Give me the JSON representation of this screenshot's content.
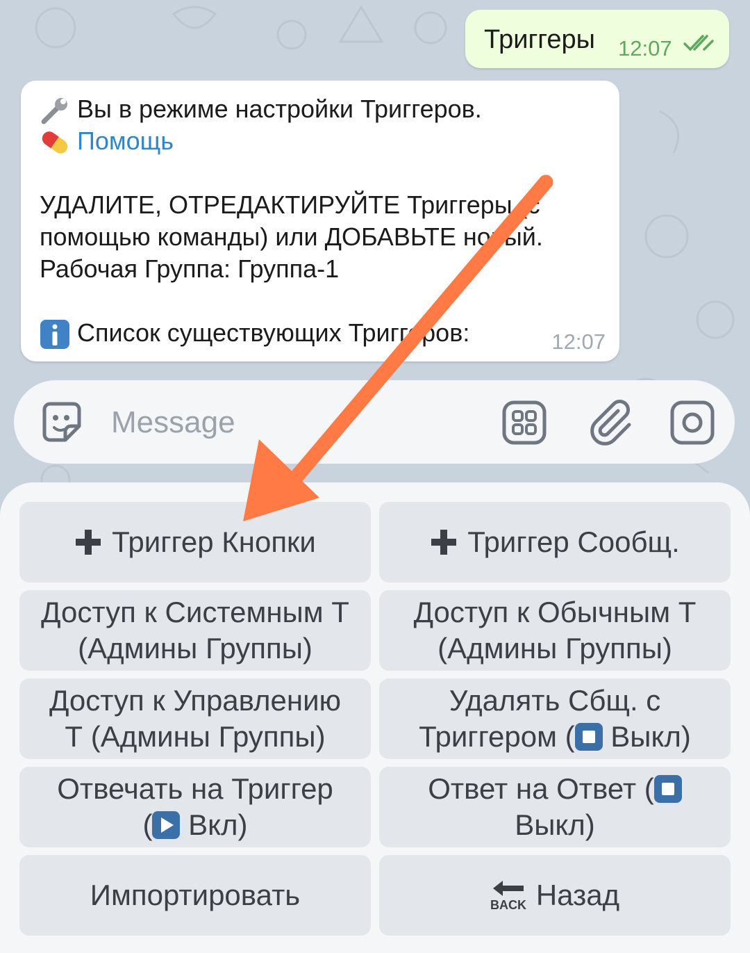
{
  "chat": {
    "outgoing": {
      "text": "Триггеры",
      "time": "12:07"
    },
    "incoming": {
      "line1": "Вы в режиме настройки Триггеров.",
      "help_link": "Помощь",
      "line3": "УДАЛИТЕ, ОТРЕДАКТИРУЙТЕ Триггеры (с",
      "line4": "помощью команды) или ДОБАВЬТЕ новый.",
      "line5": "Рабочая Группа: Группа-1",
      "line6": "Список существующих Триггеров:",
      "time": "12:07"
    }
  },
  "composer": {
    "placeholder": "Message"
  },
  "keyboard": {
    "add_button_trigger": "Триггер Кнопки",
    "add_message_trigger": "Триггер Сообщ.",
    "access_system_line1": "Доступ к Системным Т",
    "access_system_line2": "(Админы Группы)",
    "access_regular_line1": "Доступ к Обычным Т",
    "access_regular_line2": "(Админы Группы)",
    "access_manage_line1": "Доступ к Управлению",
    "access_manage_line2": "Т (Админы Группы)",
    "delete_msg_line1": "Удалять Сбщ. с",
    "delete_msg_line2_a": "Триггером (",
    "delete_msg_line2_b": " Выкл)",
    "reply_trigger_line1": "Отвечать на Триггер",
    "reply_trigger_line2_a": "(",
    "reply_trigger_line2_b": " Вкл)",
    "reply_reply_line1_a": "Ответ на Ответ (",
    "reply_reply_line2": "Выкл)",
    "import": "Импортировать",
    "back": "Назад",
    "back_icon_text": "BACK"
  },
  "colors": {
    "outgoing_bubble": "#effedd",
    "link": "#2f86c8",
    "annotation_arrow": "#ff7a45",
    "button_bg": "#e3e6ea"
  }
}
